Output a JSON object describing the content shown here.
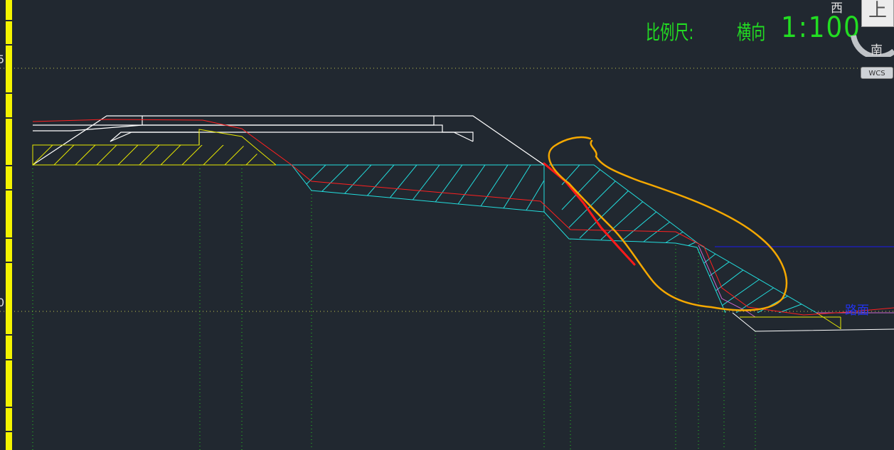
{
  "scale": {
    "label": "比例尺:",
    "direction": "横向",
    "ratio": "1:100"
  },
  "viewcube": {
    "west": "西",
    "south": "南",
    "top": "上",
    "wcs": "WCS"
  },
  "ruler": {
    "marks": [
      "5",
      "0"
    ]
  },
  "annotation_label": "路面",
  "colors": {
    "background": "#212830",
    "ruler": "#f4f400",
    "white_lines": "#ffffff",
    "red_line": "#ff2020",
    "cyan_hatch": "#22dddd",
    "yellow_hatch": "#e8e800",
    "green_dotted": "#22cc22",
    "blue_line": "#1a1aee",
    "orange_markup": "#f5a800",
    "magenta": "#cc66cc",
    "scale_text": "#22dd22"
  }
}
